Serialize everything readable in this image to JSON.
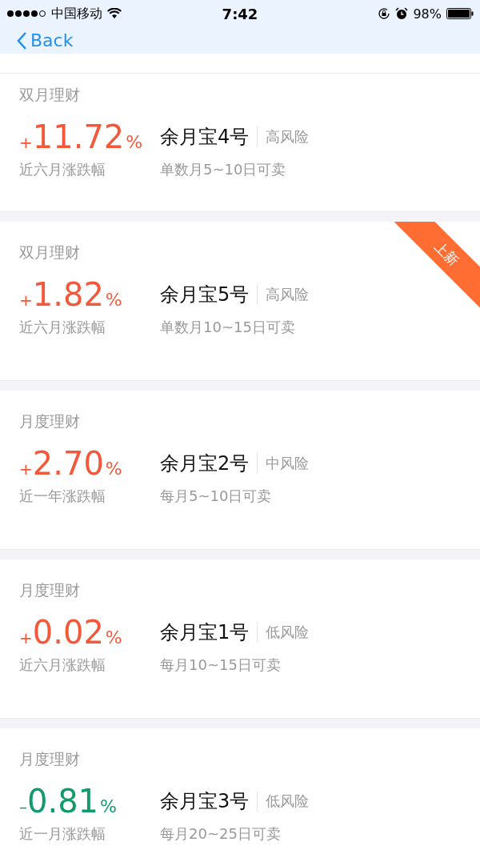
{
  "status_bar": {
    "carrier": "中国移动",
    "time": "7:42",
    "battery": "98%"
  },
  "nav": {
    "back": "Back"
  },
  "products": [
    {
      "category": "双月理财",
      "sign": "+",
      "value": "11.72",
      "unit": "%",
      "color": "#f4583a",
      "period": "近六月涨跌幅",
      "name": "余月宝4号",
      "risk": "高风险",
      "sell_window": "单数月5~10日可卖"
    },
    {
      "category": "双月理财",
      "sign": "+",
      "value": "1.82",
      "unit": "%",
      "color": "#f4583a",
      "period": "近六月涨跌幅",
      "name": "余月宝5号",
      "risk": "高风险",
      "sell_window": "单数月10~15日可卖",
      "ribbon": "上新"
    },
    {
      "category": "月度理财",
      "sign": "+",
      "value": "2.70",
      "unit": "%",
      "color": "#f4583a",
      "period": "近一年涨跌幅",
      "name": "余月宝2号",
      "risk": "中风险",
      "sell_window": "每月5~10日可卖"
    },
    {
      "category": "月度理财",
      "sign": "+",
      "value": "0.02",
      "unit": "%",
      "color": "#f4583a",
      "period": "近六月涨跌幅",
      "name": "余月宝1号",
      "risk": "低风险",
      "sell_window": "每月10~15日可卖"
    },
    {
      "category": "月度理财",
      "sign": "–",
      "value": "0.81",
      "unit": "%",
      "color": "#129a69",
      "period": "近一月涨跌幅",
      "name": "余月宝3号",
      "risk": "低风险",
      "sell_window": "每月20~25日可卖"
    }
  ]
}
